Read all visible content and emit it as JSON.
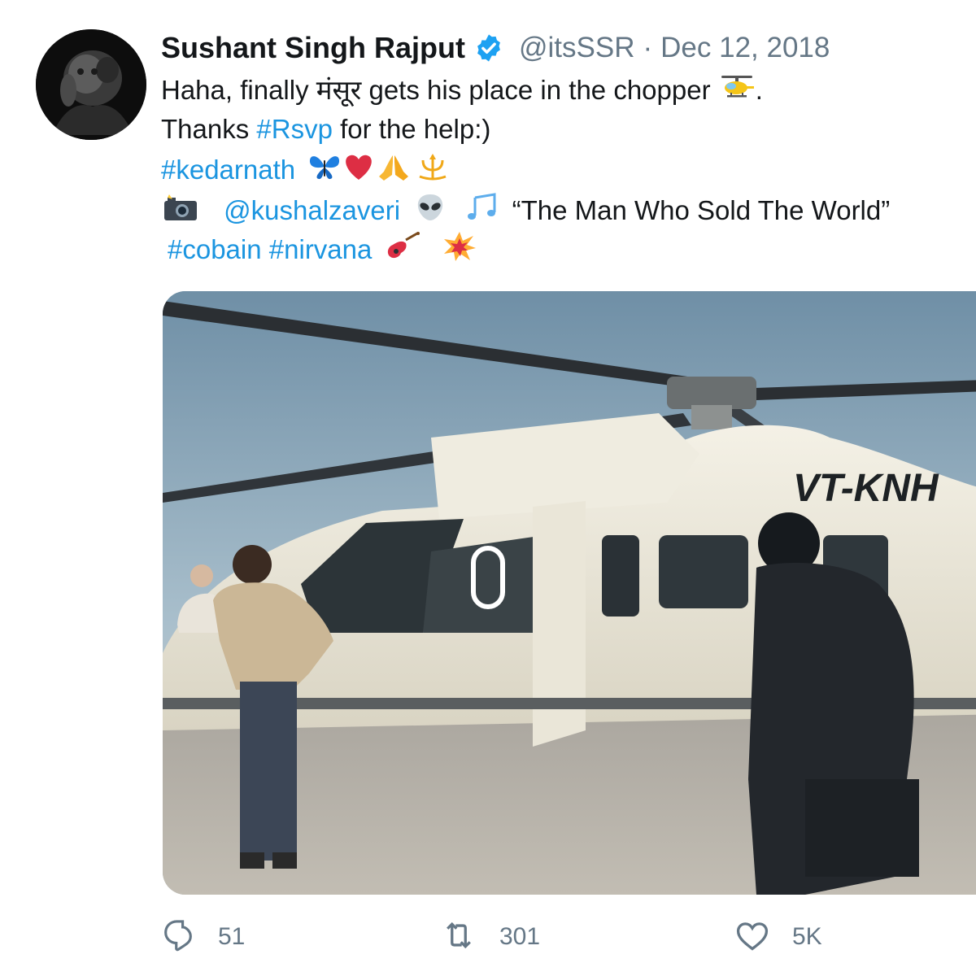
{
  "tweet": {
    "author": {
      "name": "Sushant Singh Rajput",
      "handle": "@itsSSR",
      "separator": "·",
      "date": "Dec 12, 2018"
    },
    "lines": {
      "line1_a": "Haha, finally ",
      "line1_hindi": "मंसूर",
      "line1_b": " gets his place in the chopper ",
      "line1_end": ".",
      "line2_a": "Thanks ",
      "line2_hashtag": "#Rsvp",
      "line2_b": " for the help:)",
      "line3_hashtag": "#kedarnath",
      "line4_mention": "@kushalzaveri",
      "line4_quote": "“The Man Who Sold The World”",
      "line5_hashtag1": "#cobain",
      "line5_hashtag2": "#nirvana"
    },
    "media": {
      "registration": "VT-KNH"
    },
    "actions": {
      "replies": "51",
      "retweets": "301",
      "likes": "5K"
    }
  },
  "colors": {
    "link": "#1b95e0",
    "muted": "#657786",
    "text": "#14171a",
    "verified": "#1da1f2"
  },
  "icons": [
    "verified-badge-icon",
    "helicopter-emoji",
    "butterfly-emoji",
    "red-heart-emoji",
    "folded-hands-emoji",
    "trident-emblem-emoji",
    "camera-flash-emoji",
    "alien-emoji",
    "musical-notes-emoji",
    "guitar-emoji",
    "collision-emoji",
    "reply-icon",
    "retweet-icon",
    "like-icon"
  ]
}
